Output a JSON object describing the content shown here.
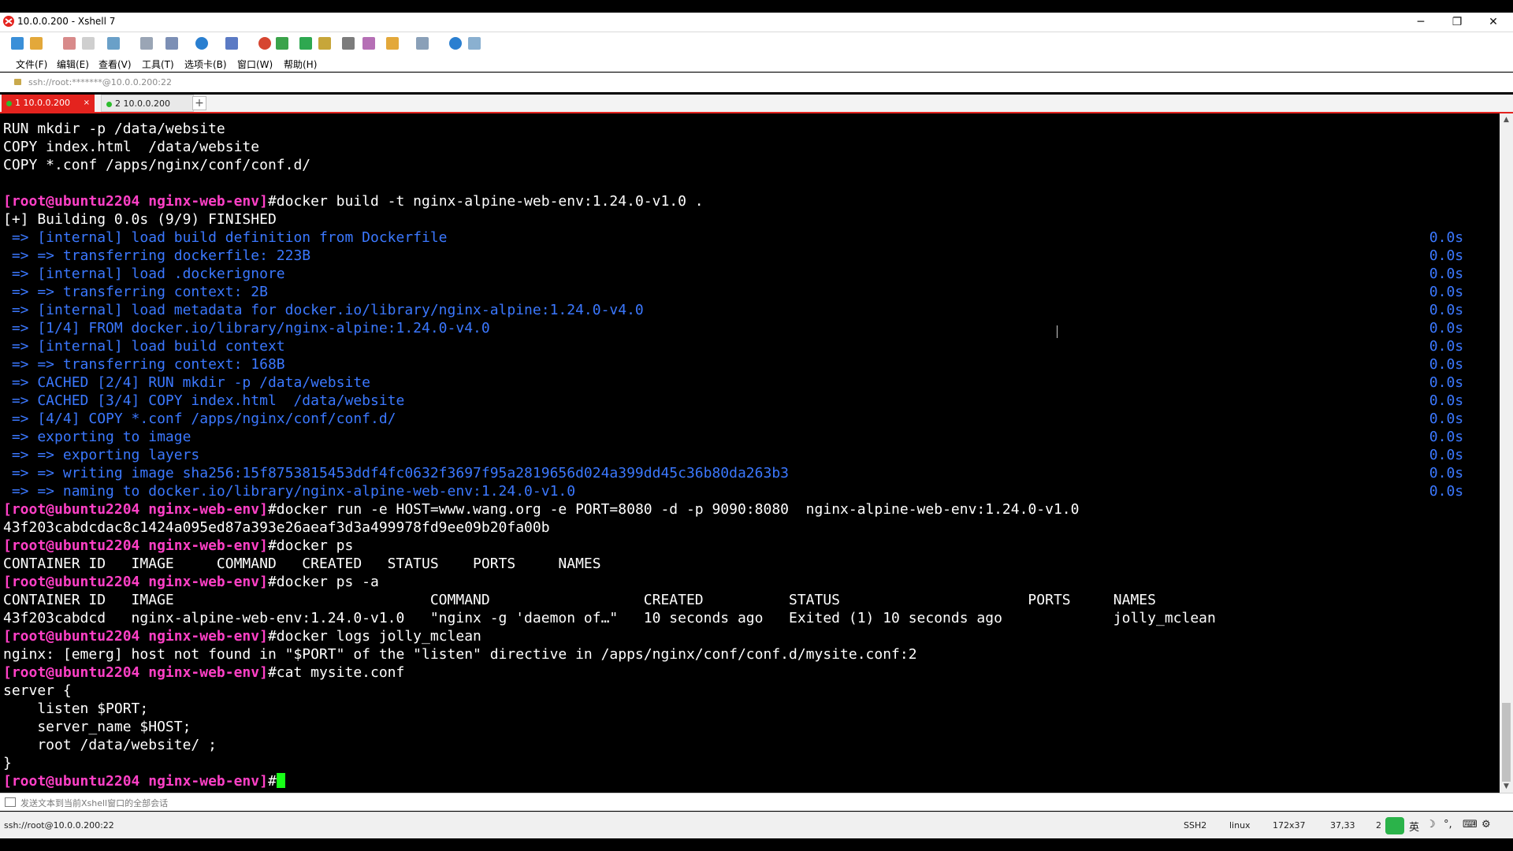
{
  "window": {
    "title": "10.0.0.200 - Xshell 7",
    "minimize": "─",
    "restore": "❐",
    "close": "✕"
  },
  "menu": [
    "文件(F)",
    "编辑(E)",
    "查看(V)",
    "工具(T)",
    "选项卡(B)",
    "窗口(W)",
    "帮助(H)"
  ],
  "address": "ssh://root:*******@10.0.0.200:22",
  "tabs": [
    {
      "label": "1 10.0.0.200",
      "close": "×"
    },
    {
      "label": "2 10.0.0.200"
    }
  ],
  "tab_add": "+",
  "terminal": {
    "prompt": "[root@ubuntu2204 nginx-web-env]",
    "lines": [
      {
        "t": "RUN mkdir -p /data/website"
      },
      {
        "t": "COPY index.html  /data/website"
      },
      {
        "t": "COPY *.conf /apps/nginx/conf/conf.d/"
      },
      {
        "t": ""
      },
      {
        "p": true,
        "t": "#docker build -t nginx-alpine-web-env:1.24.0-v1.0 ."
      },
      {
        "t": "[+] Building 0.0s (9/9) FINISHED"
      },
      {
        "b": " => [internal] load build definition from Dockerfile",
        "r": "0.0s"
      },
      {
        "b": " => => transferring dockerfile: 223B",
        "r": "0.0s"
      },
      {
        "b": " => [internal] load .dockerignore",
        "r": "0.0s"
      },
      {
        "b": " => => transferring context: 2B",
        "r": "0.0s"
      },
      {
        "b": " => [internal] load metadata for docker.io/library/nginx-alpine:1.24.0-v4.0",
        "r": "0.0s"
      },
      {
        "b": " => [1/4] FROM docker.io/library/nginx-alpine:1.24.0-v4.0",
        "r": "0.0s"
      },
      {
        "b": " => [internal] load build context",
        "r": "0.0s"
      },
      {
        "b": " => => transferring context: 168B",
        "r": "0.0s"
      },
      {
        "b": " => CACHED [2/4] RUN mkdir -p /data/website",
        "r": "0.0s"
      },
      {
        "b": " => CACHED [3/4] COPY index.html  /data/website",
        "r": "0.0s"
      },
      {
        "b": " => [4/4] COPY *.conf /apps/nginx/conf/conf.d/",
        "r": "0.0s"
      },
      {
        "b": " => exporting to image",
        "r": "0.0s"
      },
      {
        "b": " => => exporting layers",
        "r": "0.0s"
      },
      {
        "b": " => => writing image sha256:15f8753815453ddf4fc0632f3697f95a2819656d024a399dd45c36b80da263b3",
        "r": "0.0s"
      },
      {
        "b": " => => naming to docker.io/library/nginx-alpine-web-env:1.24.0-v1.0",
        "r": "0.0s"
      },
      {
        "p": true,
        "t": "#docker run -e HOST=www.wang.org -e PORT=8080 -d -p 9090:8080  nginx-alpine-web-env:1.24.0-v1.0"
      },
      {
        "t": "43f203cabdcdac8c1424a095ed87a393e26aeaf3d3a499978fd9ee09b20fa00b"
      },
      {
        "p": true,
        "t": "#docker ps"
      },
      {
        "t": "CONTAINER ID   IMAGE     COMMAND   CREATED   STATUS    PORTS     NAMES"
      },
      {
        "p": true,
        "t": "#docker ps -a"
      },
      {
        "t": "CONTAINER ID   IMAGE                              COMMAND                  CREATED          STATUS                      PORTS     NAMES"
      },
      {
        "t": "43f203cabdcd   nginx-alpine-web-env:1.24.0-v1.0   \"nginx -g 'daemon of…\"   10 seconds ago   Exited (1) 10 seconds ago             jolly_mclean"
      },
      {
        "p": true,
        "t": "#docker logs jolly_mclean"
      },
      {
        "t": "nginx: [emerg] host not found in \"$PORT\" of the \"listen\" directive in /apps/nginx/conf/conf.d/mysite.conf:2"
      },
      {
        "p": true,
        "t": "#cat mysite.conf"
      },
      {
        "t": "server {"
      },
      {
        "t": "    listen $PORT;"
      },
      {
        "t": "    server_name $HOST;"
      },
      {
        "t": "    root /data/website/ ;"
      },
      {
        "t": "}"
      },
      {
        "p": true,
        "t": "#",
        "cursor": true
      }
    ]
  },
  "compose_hint": "发送文本到当前Xshell窗口的全部会话",
  "status": {
    "conn": "ssh://root@10.0.0.200:22",
    "proto": "SSH2",
    "term": "linux",
    "size": "172x37",
    "pos": "37,33",
    "sessions": "2",
    "ime": "英"
  }
}
